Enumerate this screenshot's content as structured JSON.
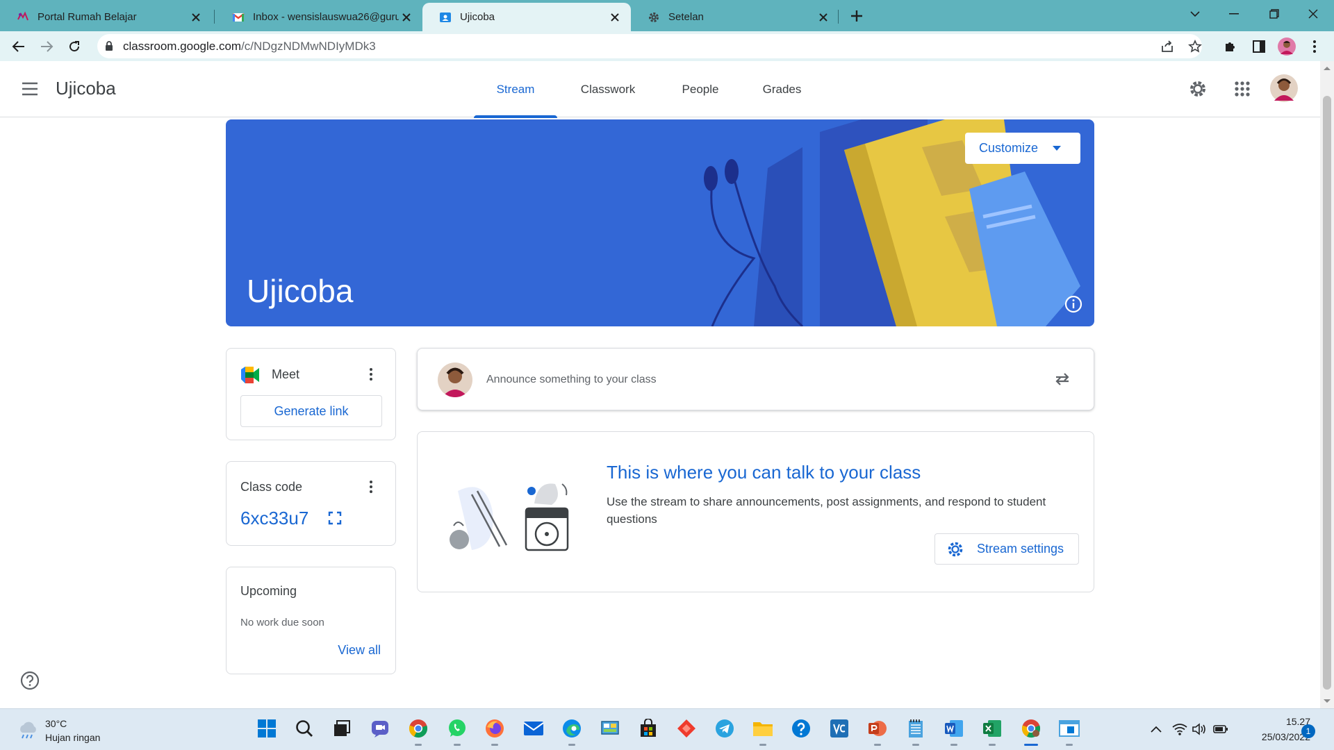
{
  "browser": {
    "tabs": [
      {
        "title": "Portal Rumah Belajar"
      },
      {
        "title": "Inbox - wensislauswua26@guru.s"
      },
      {
        "title": "Ujicoba"
      },
      {
        "title": "Setelan"
      }
    ],
    "url_host": "classroom.google.com",
    "url_path": "/c/NDgzNDMwNDIyMDk3"
  },
  "app": {
    "class_name": "Ujicoba",
    "nav_tabs": [
      "Stream",
      "Classwork",
      "People",
      "Grades"
    ]
  },
  "banner": {
    "title": "Ujicoba",
    "customize_label": "Customize"
  },
  "meet": {
    "label": "Meet",
    "generate_label": "Generate link"
  },
  "class_code": {
    "label": "Class code",
    "value": "6xc33u7"
  },
  "upcoming": {
    "title": "Upcoming",
    "empty_text": "No work due soon",
    "view_all_label": "View all"
  },
  "announce": {
    "placeholder": "Announce something to your class"
  },
  "info": {
    "title": "This is where you can talk to your class",
    "description": "Use the stream to share announcements, post assignments, and respond to student questions",
    "settings_label": "Stream settings"
  },
  "taskbar": {
    "weather_temp": "30°C",
    "weather_desc": "Hujan ringan",
    "time": "15.27",
    "date": "25/03/2022",
    "notification_count": "1"
  },
  "colors": {
    "accent": "#1967d2",
    "banner": "#3367d6",
    "chrome_frame": "#5fb3bd"
  }
}
